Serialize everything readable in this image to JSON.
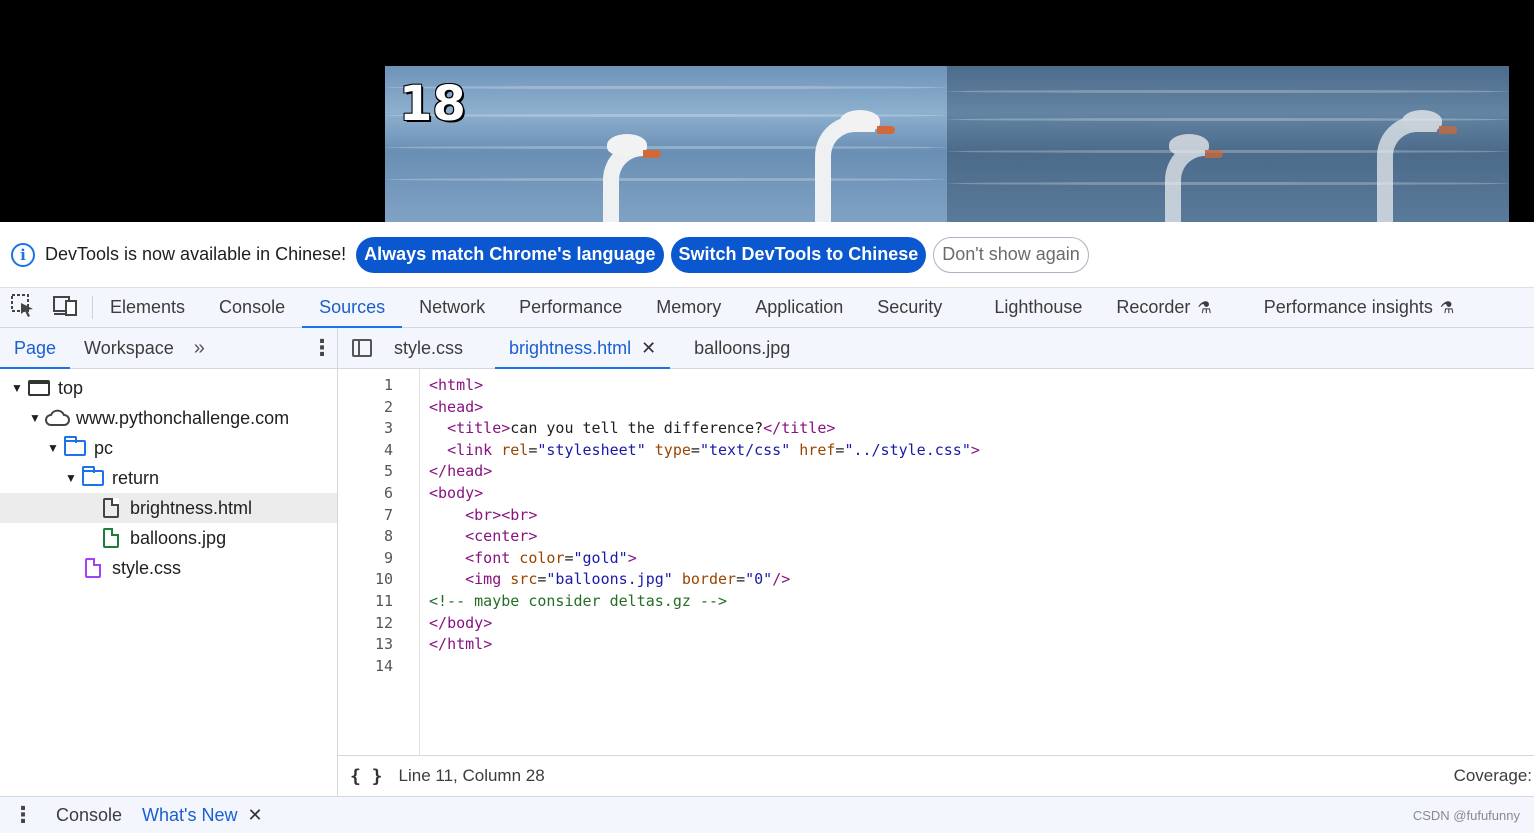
{
  "webpage": {
    "image_number": "18"
  },
  "banner": {
    "message": "DevTools is now available in Chinese!",
    "match_language_label": "Always match Chrome's language",
    "switch_label": "Switch DevTools to Chinese",
    "dismiss_label": "Don't show again"
  },
  "main_tabs": [
    {
      "label": "Elements"
    },
    {
      "label": "Console"
    },
    {
      "label": "Sources"
    },
    {
      "label": "Network"
    },
    {
      "label": "Performance"
    },
    {
      "label": "Memory"
    },
    {
      "label": "Application"
    },
    {
      "label": "Security"
    },
    {
      "label": "Lighthouse"
    },
    {
      "label": "Recorder"
    },
    {
      "label": "Performance insights"
    }
  ],
  "active_main_tab": "Sources",
  "navigator": {
    "tabs": [
      {
        "label": "Page"
      },
      {
        "label": "Workspace"
      }
    ],
    "more": "»",
    "tree": [
      {
        "label": "top"
      },
      {
        "label": "www.pythonchallenge.com"
      },
      {
        "label": "pc"
      },
      {
        "label": "return"
      },
      {
        "label": "brightness.html"
      },
      {
        "label": "balloons.jpg"
      },
      {
        "label": "style.css"
      }
    ]
  },
  "editor": {
    "tabs": [
      {
        "label": "style.css"
      },
      {
        "label": "brightness.html"
      },
      {
        "label": "balloons.jpg"
      }
    ],
    "active_tab": "brightness.html",
    "line_numbers": [
      "1",
      "2",
      "3",
      "4",
      "5",
      "6",
      "7",
      "8",
      "9",
      "10",
      "11",
      "12",
      "13",
      "14"
    ],
    "lines": [
      "<html>",
      "<head>",
      "  <title>can you tell the difference?</title>",
      "  <link rel=\"stylesheet\" type=\"text/css\" href=\"../style.css\">",
      "</head>",
      "<body>",
      "    <br><br>",
      "    <center>",
      "    <font color=\"gold\">",
      "    <img src=\"balloons.jpg\" border=\"0\"/>",
      "<!-- maybe consider deltas.gz -->",
      "</body>",
      "</html>",
      ""
    ],
    "status": "Line 11, Column 28",
    "coverage": "Coverage:"
  },
  "drawer": {
    "tabs": [
      {
        "label": "Console"
      },
      {
        "label": "What's New"
      }
    ],
    "watermark": "CSDN @fufufunny"
  },
  "colors": {
    "accent": "#1a73e8",
    "primary_button": "#0b57d0",
    "tag": "#881280",
    "attribute": "#994500",
    "value": "#1a1aa6",
    "comment": "#236e25"
  }
}
